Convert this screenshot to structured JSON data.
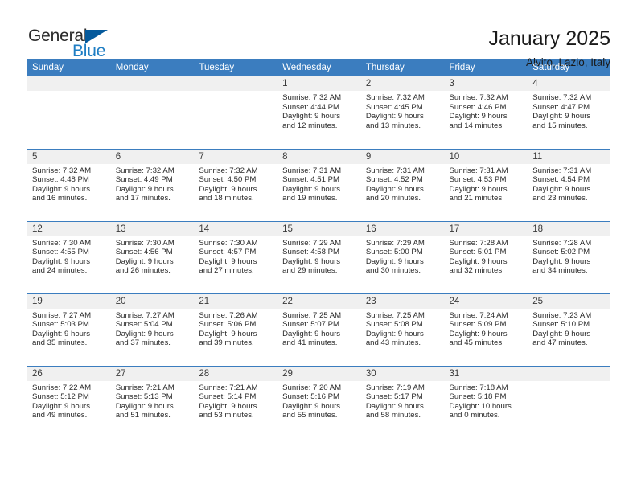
{
  "brand": {
    "name_top": "General",
    "name_bottom": "Blue",
    "color_dark": "#2b2b2b",
    "color_blue": "#1f7ec4",
    "triangle_color": "#055a9c"
  },
  "header": {
    "title": "January 2025",
    "subtitle": "Alvito, Lazio, Italy"
  },
  "theme": {
    "header_bg": "#3b7dbf",
    "header_text": "#ffffff",
    "row_divider": "#3b7dbf",
    "daynum_bg": "#f0f0f0"
  },
  "weekdays": [
    "Sunday",
    "Monday",
    "Tuesday",
    "Wednesday",
    "Thursday",
    "Friday",
    "Saturday"
  ],
  "labels": {
    "sunrise": "Sunrise:",
    "sunset": "Sunset:",
    "daylight": "Daylight:"
  },
  "weeks": [
    [
      {
        "day": "",
        "sunrise": "",
        "sunset": "",
        "daylight_1": "",
        "daylight_2": ""
      },
      {
        "day": "",
        "sunrise": "",
        "sunset": "",
        "daylight_1": "",
        "daylight_2": ""
      },
      {
        "day": "",
        "sunrise": "",
        "sunset": "",
        "daylight_1": "",
        "daylight_2": ""
      },
      {
        "day": "1",
        "sunrise": "Sunrise: 7:32 AM",
        "sunset": "Sunset: 4:44 PM",
        "daylight_1": "Daylight: 9 hours",
        "daylight_2": "and 12 minutes."
      },
      {
        "day": "2",
        "sunrise": "Sunrise: 7:32 AM",
        "sunset": "Sunset: 4:45 PM",
        "daylight_1": "Daylight: 9 hours",
        "daylight_2": "and 13 minutes."
      },
      {
        "day": "3",
        "sunrise": "Sunrise: 7:32 AM",
        "sunset": "Sunset: 4:46 PM",
        "daylight_1": "Daylight: 9 hours",
        "daylight_2": "and 14 minutes."
      },
      {
        "day": "4",
        "sunrise": "Sunrise: 7:32 AM",
        "sunset": "Sunset: 4:47 PM",
        "daylight_1": "Daylight: 9 hours",
        "daylight_2": "and 15 minutes."
      }
    ],
    [
      {
        "day": "5",
        "sunrise": "Sunrise: 7:32 AM",
        "sunset": "Sunset: 4:48 PM",
        "daylight_1": "Daylight: 9 hours",
        "daylight_2": "and 16 minutes."
      },
      {
        "day": "6",
        "sunrise": "Sunrise: 7:32 AM",
        "sunset": "Sunset: 4:49 PM",
        "daylight_1": "Daylight: 9 hours",
        "daylight_2": "and 17 minutes."
      },
      {
        "day": "7",
        "sunrise": "Sunrise: 7:32 AM",
        "sunset": "Sunset: 4:50 PM",
        "daylight_1": "Daylight: 9 hours",
        "daylight_2": "and 18 minutes."
      },
      {
        "day": "8",
        "sunrise": "Sunrise: 7:31 AM",
        "sunset": "Sunset: 4:51 PM",
        "daylight_1": "Daylight: 9 hours",
        "daylight_2": "and 19 minutes."
      },
      {
        "day": "9",
        "sunrise": "Sunrise: 7:31 AM",
        "sunset": "Sunset: 4:52 PM",
        "daylight_1": "Daylight: 9 hours",
        "daylight_2": "and 20 minutes."
      },
      {
        "day": "10",
        "sunrise": "Sunrise: 7:31 AM",
        "sunset": "Sunset: 4:53 PM",
        "daylight_1": "Daylight: 9 hours",
        "daylight_2": "and 21 minutes."
      },
      {
        "day": "11",
        "sunrise": "Sunrise: 7:31 AM",
        "sunset": "Sunset: 4:54 PM",
        "daylight_1": "Daylight: 9 hours",
        "daylight_2": "and 23 minutes."
      }
    ],
    [
      {
        "day": "12",
        "sunrise": "Sunrise: 7:30 AM",
        "sunset": "Sunset: 4:55 PM",
        "daylight_1": "Daylight: 9 hours",
        "daylight_2": "and 24 minutes."
      },
      {
        "day": "13",
        "sunrise": "Sunrise: 7:30 AM",
        "sunset": "Sunset: 4:56 PM",
        "daylight_1": "Daylight: 9 hours",
        "daylight_2": "and 26 minutes."
      },
      {
        "day": "14",
        "sunrise": "Sunrise: 7:30 AM",
        "sunset": "Sunset: 4:57 PM",
        "daylight_1": "Daylight: 9 hours",
        "daylight_2": "and 27 minutes."
      },
      {
        "day": "15",
        "sunrise": "Sunrise: 7:29 AM",
        "sunset": "Sunset: 4:58 PM",
        "daylight_1": "Daylight: 9 hours",
        "daylight_2": "and 29 minutes."
      },
      {
        "day": "16",
        "sunrise": "Sunrise: 7:29 AM",
        "sunset": "Sunset: 5:00 PM",
        "daylight_1": "Daylight: 9 hours",
        "daylight_2": "and 30 minutes."
      },
      {
        "day": "17",
        "sunrise": "Sunrise: 7:28 AM",
        "sunset": "Sunset: 5:01 PM",
        "daylight_1": "Daylight: 9 hours",
        "daylight_2": "and 32 minutes."
      },
      {
        "day": "18",
        "sunrise": "Sunrise: 7:28 AM",
        "sunset": "Sunset: 5:02 PM",
        "daylight_1": "Daylight: 9 hours",
        "daylight_2": "and 34 minutes."
      }
    ],
    [
      {
        "day": "19",
        "sunrise": "Sunrise: 7:27 AM",
        "sunset": "Sunset: 5:03 PM",
        "daylight_1": "Daylight: 9 hours",
        "daylight_2": "and 35 minutes."
      },
      {
        "day": "20",
        "sunrise": "Sunrise: 7:27 AM",
        "sunset": "Sunset: 5:04 PM",
        "daylight_1": "Daylight: 9 hours",
        "daylight_2": "and 37 minutes."
      },
      {
        "day": "21",
        "sunrise": "Sunrise: 7:26 AM",
        "sunset": "Sunset: 5:06 PM",
        "daylight_1": "Daylight: 9 hours",
        "daylight_2": "and 39 minutes."
      },
      {
        "day": "22",
        "sunrise": "Sunrise: 7:25 AM",
        "sunset": "Sunset: 5:07 PM",
        "daylight_1": "Daylight: 9 hours",
        "daylight_2": "and 41 minutes."
      },
      {
        "day": "23",
        "sunrise": "Sunrise: 7:25 AM",
        "sunset": "Sunset: 5:08 PM",
        "daylight_1": "Daylight: 9 hours",
        "daylight_2": "and 43 minutes."
      },
      {
        "day": "24",
        "sunrise": "Sunrise: 7:24 AM",
        "sunset": "Sunset: 5:09 PM",
        "daylight_1": "Daylight: 9 hours",
        "daylight_2": "and 45 minutes."
      },
      {
        "day": "25",
        "sunrise": "Sunrise: 7:23 AM",
        "sunset": "Sunset: 5:10 PM",
        "daylight_1": "Daylight: 9 hours",
        "daylight_2": "and 47 minutes."
      }
    ],
    [
      {
        "day": "26",
        "sunrise": "Sunrise: 7:22 AM",
        "sunset": "Sunset: 5:12 PM",
        "daylight_1": "Daylight: 9 hours",
        "daylight_2": "and 49 minutes."
      },
      {
        "day": "27",
        "sunrise": "Sunrise: 7:21 AM",
        "sunset": "Sunset: 5:13 PM",
        "daylight_1": "Daylight: 9 hours",
        "daylight_2": "and 51 minutes."
      },
      {
        "day": "28",
        "sunrise": "Sunrise: 7:21 AM",
        "sunset": "Sunset: 5:14 PM",
        "daylight_1": "Daylight: 9 hours",
        "daylight_2": "and 53 minutes."
      },
      {
        "day": "29",
        "sunrise": "Sunrise: 7:20 AM",
        "sunset": "Sunset: 5:16 PM",
        "daylight_1": "Daylight: 9 hours",
        "daylight_2": "and 55 minutes."
      },
      {
        "day": "30",
        "sunrise": "Sunrise: 7:19 AM",
        "sunset": "Sunset: 5:17 PM",
        "daylight_1": "Daylight: 9 hours",
        "daylight_2": "and 58 minutes."
      },
      {
        "day": "31",
        "sunrise": "Sunrise: 7:18 AM",
        "sunset": "Sunset: 5:18 PM",
        "daylight_1": "Daylight: 10 hours",
        "daylight_2": "and 0 minutes."
      },
      {
        "day": "",
        "sunrise": "",
        "sunset": "",
        "daylight_1": "",
        "daylight_2": ""
      }
    ]
  ]
}
